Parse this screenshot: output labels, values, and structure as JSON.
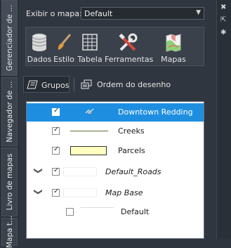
{
  "left_tabs": [
    {
      "label": "Gerenciador de ..."
    },
    {
      "label": "Navegador de ..."
    },
    {
      "label": "Livro de mapas"
    },
    {
      "label": "Mapa t..."
    }
  ],
  "map_selector": {
    "label": "Exibir o mapa:",
    "value": "Default"
  },
  "toolbar": {
    "dados": "Dados",
    "estilo": "Estilo",
    "tabela": "Tabela",
    "ferramentas": "Ferramentas",
    "mapas": "Mapas"
  },
  "tabs": {
    "grupos": "Grupos",
    "ordem": "Ordem do desenho"
  },
  "layers": [
    {
      "label": "Downtown Redding",
      "checked": true,
      "selected": true
    },
    {
      "label": "Creeks",
      "checked": true
    },
    {
      "label": "Parcels",
      "checked": true,
      "fill_color": "#ffffc0"
    },
    {
      "label": "Default_Roads",
      "checked": true,
      "group": true
    },
    {
      "label": "Map Base",
      "checked": true,
      "group": true
    },
    {
      "label": "Default",
      "checked": false
    }
  ],
  "colors": {
    "selection": "#1e8fe0",
    "panel": "#30363f"
  }
}
